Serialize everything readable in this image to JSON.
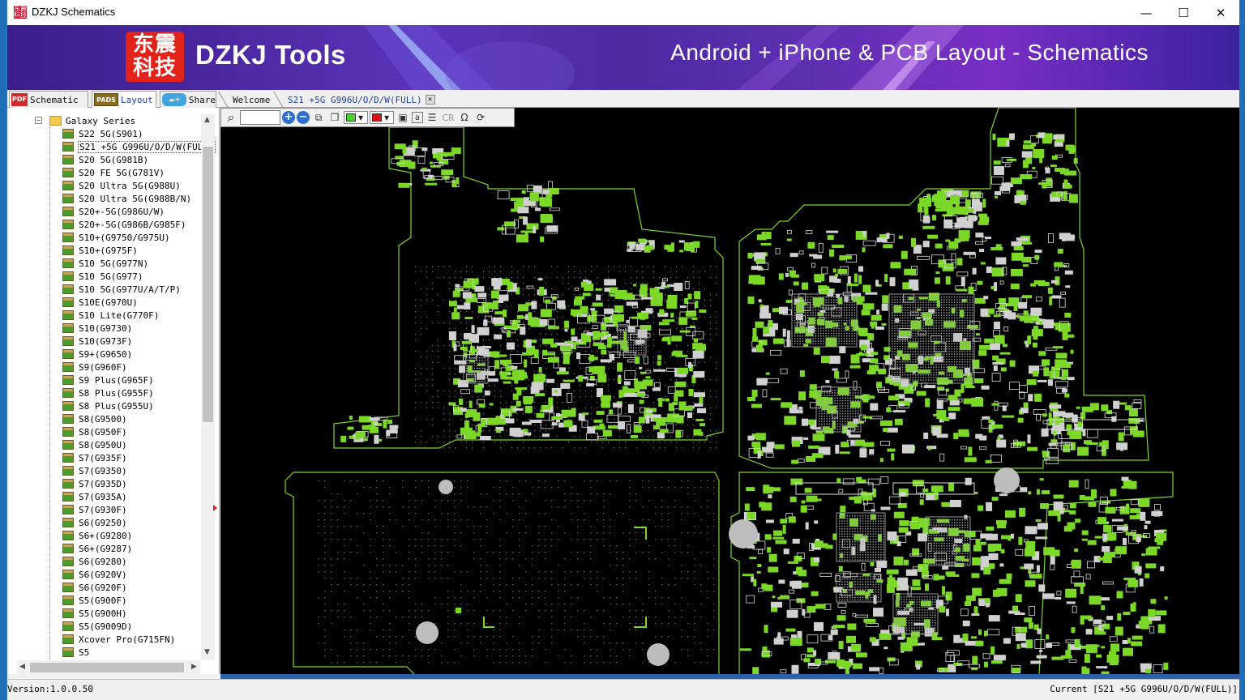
{
  "window": {
    "title": "DZKJ Schematics",
    "app_icon_text": "东震科技",
    "minimize_glyph": "—",
    "maximize_glyph": "☐",
    "close_glyph": "✕"
  },
  "banner": {
    "logo_chars": "东震科技",
    "logo_text": "DZKJ Tools",
    "tagline": "Android + iPhone & PCB Layout - Schematics"
  },
  "main_tabs": [
    {
      "icon_text": "PDF",
      "label": "Schematic",
      "icon_color": "#d12a2a",
      "active": false
    },
    {
      "icon_text": "PADS",
      "label": "Layout",
      "icon_color": "#8a6d1f",
      "active": true
    },
    {
      "icon_text": "",
      "label": "Share",
      "icon_color": "#3fa4e0",
      "active": false
    }
  ],
  "doc_tabs": [
    {
      "label": "Welcome"
    },
    {
      "label": "S21 +5G G996U/O/D/W(FULL)",
      "close_glyph": "✕"
    }
  ],
  "tree": {
    "group_label": "Galaxy Series",
    "collapse_glyph": "−",
    "items": [
      "S22 5G(S901)",
      "S21 +5G G996U/O/D/W(FULL)",
      "S20 5G(G981B)",
      "S20 FE 5G(G781V)",
      "S20 Ultra 5G(G988U)",
      "S20 Ultra 5G(G988B/N)",
      "S20+-5G(G986U/W)",
      "S20+-5G(G986B/G985F)",
      "S10+(G9750/G975U)",
      "S10+(G975F)",
      "S10 5G(G977N)",
      "S10 5G(G977)",
      "S10 5G(G977U/A/T/P)",
      "S10E(G970U)",
      "S10 Lite(G770F)",
      "S10(G9730)",
      "S10(G973F)",
      "S9+(G9650)",
      "S9(G960F)",
      "S9 Plus(G965F)",
      "S8 Plus(G955F)",
      "S8 Plus(G955U)",
      "S8(G9500)",
      "S8(G950F)",
      "S8(G950U)",
      "S7(G935F)",
      "S7(G9350)",
      "S7(G935D)",
      "S7(G935A)",
      "S7(G930F)",
      "S6(G9250)",
      "S6+(G9280)",
      "S6+(G9287)",
      "S6(G9280)",
      "S6(G920V)",
      "S6(G920F)",
      "S5(G900F)",
      "S5(G900H)",
      "S5(G9009D)",
      "Xcover Pro(G715FN)",
      "S5"
    ],
    "selected_index": 1,
    "scroll_up": "▲",
    "scroll_down": "▼",
    "scroll_left": "◀",
    "scroll_right": "▶"
  },
  "toolbar": {
    "search_icon": "⌕",
    "zoom_value": "",
    "zoom_in": "+",
    "zoom_out": "−",
    "fg_color": "#44d62c",
    "bg_color": "#e01010",
    "dropdown_glyph": "▼",
    "cr_label": "CR",
    "omega_label": "Ω",
    "a_label": "a"
  },
  "status": {
    "version": "Version:1.0.0.50",
    "current": "Current [S21 +5G G996U/O/D/W(FULL)]"
  },
  "colors": {
    "board_outline": "#7cd826",
    "component": "#7cd826",
    "pad": "#d0d0d0",
    "canvas_bg": "#000000"
  }
}
